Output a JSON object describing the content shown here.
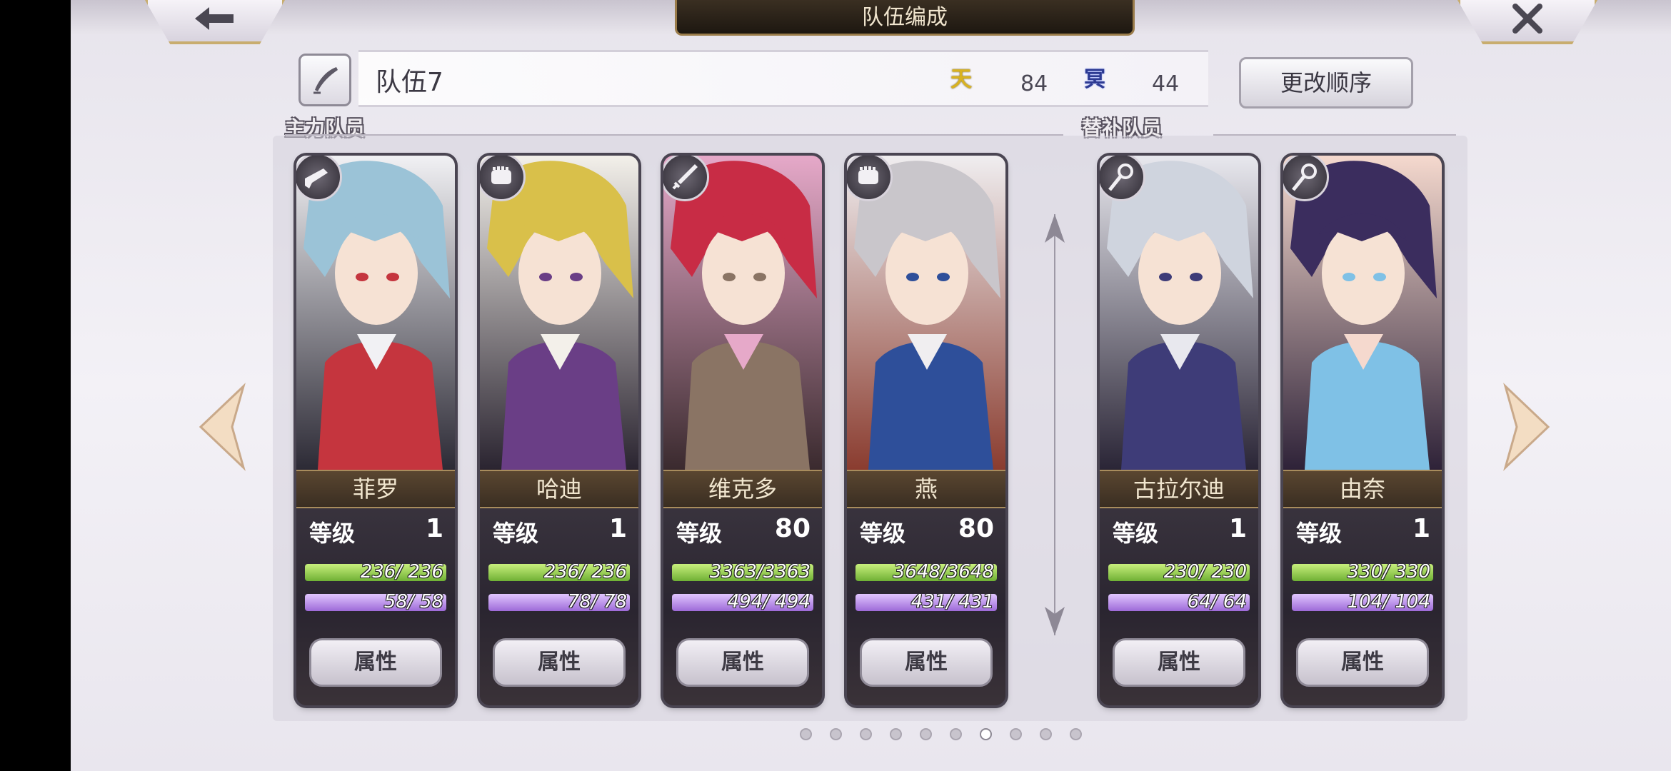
{
  "header": {
    "title": "队伍编成"
  },
  "team": {
    "name": "队伍7",
    "attr_heaven_glyph": "天",
    "attr_heaven_value": "84",
    "attr_hell_glyph": "冥",
    "attr_hell_value": "44",
    "order_button_label": "更改顺序"
  },
  "sections": {
    "main_label": "主力队员",
    "sub_label": "替补队员"
  },
  "labels": {
    "level": "等级",
    "attributes": "属性"
  },
  "cards": [
    {
      "name": "菲罗",
      "level": "1",
      "hp": "236/ 236",
      "mp": "58/ 58",
      "hp_fill": 1,
      "mp_fill": 1,
      "role_icon": "gun-icon",
      "palette": [
        "#f1f1f4",
        "#9bc3d7",
        "#c5353e",
        "#2c2a35"
      ]
    },
    {
      "name": "哈迪",
      "level": "1",
      "hp": "236/ 236",
      "mp": "78/ 78",
      "hp_fill": 1,
      "mp_fill": 1,
      "role_icon": "fist-icon",
      "palette": [
        "#f3f0ea",
        "#d9c04a",
        "#6a3e86",
        "#2a2430"
      ]
    },
    {
      "name": "维克多",
      "level": "80",
      "hp": "3363/3363",
      "mp": "494/ 494",
      "hp_fill": 1,
      "mp_fill": 1,
      "role_icon": "sword-icon",
      "palette": [
        "#e6a9c9",
        "#c82c45",
        "#8a7464",
        "#3a2a2e"
      ]
    },
    {
      "name": "燕",
      "level": "80",
      "hp": "3648/3648",
      "mp": "431/ 431",
      "hp_fill": 1,
      "mp_fill": 1,
      "role_icon": "fist-icon",
      "palette": [
        "#f0eef0",
        "#c9c6cb",
        "#2e4f9a",
        "#8a3c2f"
      ]
    },
    {
      "name": "古拉尔迪",
      "level": "1",
      "hp": "230/ 230",
      "mp": "64/ 64",
      "hp_fill": 1,
      "mp_fill": 1,
      "role_icon": "staff-icon",
      "palette": [
        "#e8e8ee",
        "#cfd4de",
        "#3e3c78",
        "#2a2536"
      ]
    },
    {
      "name": "由奈",
      "level": "1",
      "hp": "330/ 330",
      "mp": "104/ 104",
      "hp_fill": 1,
      "mp_fill": 1,
      "role_icon": "staff-icon",
      "palette": [
        "#f5d9ce",
        "#3b2d5e",
        "#7fc1e6",
        "#2e2238"
      ]
    }
  ],
  "pagination": {
    "total": 10,
    "active": 7
  }
}
